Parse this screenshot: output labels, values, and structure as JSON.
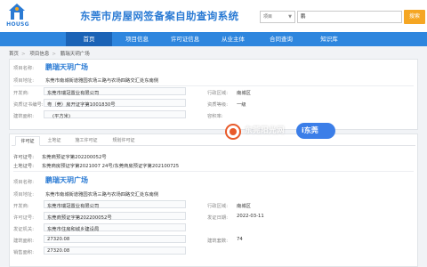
{
  "header": {
    "logo_text": "HOUSG",
    "site_title": "东莞市房屋网签备案自助查询系统",
    "search_type": "项目",
    "search_value": "鹏",
    "search_button": "搜索"
  },
  "nav": [
    "首页",
    "项目信息",
    "许可证信息",
    "从业主体",
    "合同查询",
    "知识库"
  ],
  "breadcrumb": [
    "首页",
    "项目信息",
    "鹏瑞天玥广场"
  ],
  "top_panel": {
    "project_name": "鹏瑞天玥广场",
    "address_label": "项目地址:",
    "address_value": "东莞市南城街道雅园农场三路与农场四路交汇处东南侧",
    "developer_label": "开发商:",
    "developer_value": "东莞市瑞冠置业有限公司",
    "district_label": "行政区域:",
    "district_value": "南城区",
    "cert_label": "资质证书编号:",
    "cert_value": "粤（莞）房开证字第1001830号",
    "grade_label": "资质等级:",
    "grade_value": "一级",
    "area_label": "建筑面积:",
    "area_value": "(平方米)",
    "usage_label": "容积率:"
  },
  "tabs": [
    "许可证",
    "土地证",
    "施工许可证",
    "规划许可证"
  ],
  "permit_block": {
    "permit_label": "许可证号:",
    "permit_value": "东莞商预证字第202200052号",
    "land_label": "土地证号:",
    "land_value": "东莞商房预证字第2021007 24号/东莞商房预证字第202100725"
  },
  "bottom_panel": {
    "project_label": "项目名称:",
    "project_name": "鹏瑞天玥广场",
    "address_label": "项目地址:",
    "address_value": "东莞市南城街道雅园农场三路与农场四路交汇处东南侧",
    "district_label": "行政区域:",
    "district_value": "南城区",
    "developer_label": "开发商:",
    "developer_value": "东莞市瑞冠置业有限公司",
    "permit_label": "许可证号:",
    "permit_value": "东莞商预证字第202200052号",
    "issue_label": "发证机关:",
    "issue_value": "东莞市住房和城乡建设局",
    "date_label": "发证日期:",
    "date_value": "2022-03-11",
    "area_label": "建筑面积:",
    "area_value": "27320.08",
    "units_label": "建筑套数:",
    "units_value": "74",
    "sale_area_label": "销售面积:",
    "sale_area_value": "27320.08"
  },
  "watermark": {
    "text": "东莞阳光网",
    "badge": "i东莞"
  }
}
